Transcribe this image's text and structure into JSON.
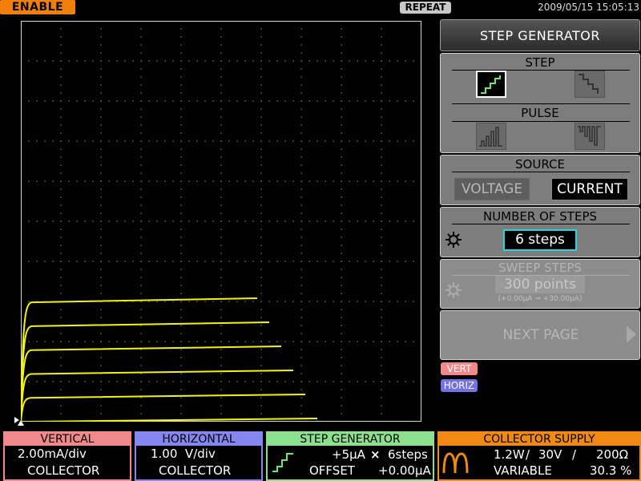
{
  "topbar": {
    "enable": "ENABLE",
    "repeat": "REPEAT",
    "datetime": "2009/05/15 15:05:13"
  },
  "trace": {
    "color": "#f2f20f",
    "curves": [
      {
        "y": 0.3,
        "x_end": 5.9
      },
      {
        "y": 0.24,
        "x_end": 6.2
      },
      {
        "y": 0.18,
        "x_end": 6.5
      },
      {
        "y": 0.12,
        "x_end": 6.8
      },
      {
        "y": 0.06,
        "x_end": 7.1
      },
      {
        "y": 0.0,
        "x_end": 7.4
      }
    ]
  },
  "panel": {
    "title": "STEP GENERATOR",
    "step_label": "STEP",
    "step_icons": [
      "step-up-icon",
      "step-down-icon"
    ],
    "pulse_label": "PULSE",
    "pulse_icons": [
      "pulse-up-icon",
      "pulse-down-icon"
    ],
    "source_label": "SOURCE",
    "voltage": "VOLTAGE",
    "current": "CURRENT",
    "num_steps_label": "NUMBER OF STEPS",
    "num_steps_value": "6 steps",
    "sweep_label": "SWEEP STEPS",
    "sweep_value": "300 points",
    "sweep_range": "(+0.00μA ⇒ +30.00μA)",
    "next_page": "NEXT PAGE"
  },
  "tags": {
    "vert": "VERT",
    "horiz": "HORIZ"
  },
  "vertical": {
    "title": "VERTICAL",
    "scale": "2.00mA/div",
    "source": "COLLECTOR"
  },
  "horizontal": {
    "title": "HORIZONTAL",
    "scale": "1.00  V/div",
    "source": "COLLECTOR"
  },
  "step_gen": {
    "title": "STEP GENERATOR",
    "step": "+5μA",
    "times": "×",
    "steps": "6steps",
    "offset_label": "OFFSET",
    "offset_value": "+0.00μA"
  },
  "collector_supply": {
    "title": "COLLECTOR SUPPLY",
    "power": "1.2W",
    "voltage": "30V",
    "resistance": "200Ω",
    "sep": "/",
    "mode": "VARIABLE",
    "percent": "30.3 %"
  }
}
